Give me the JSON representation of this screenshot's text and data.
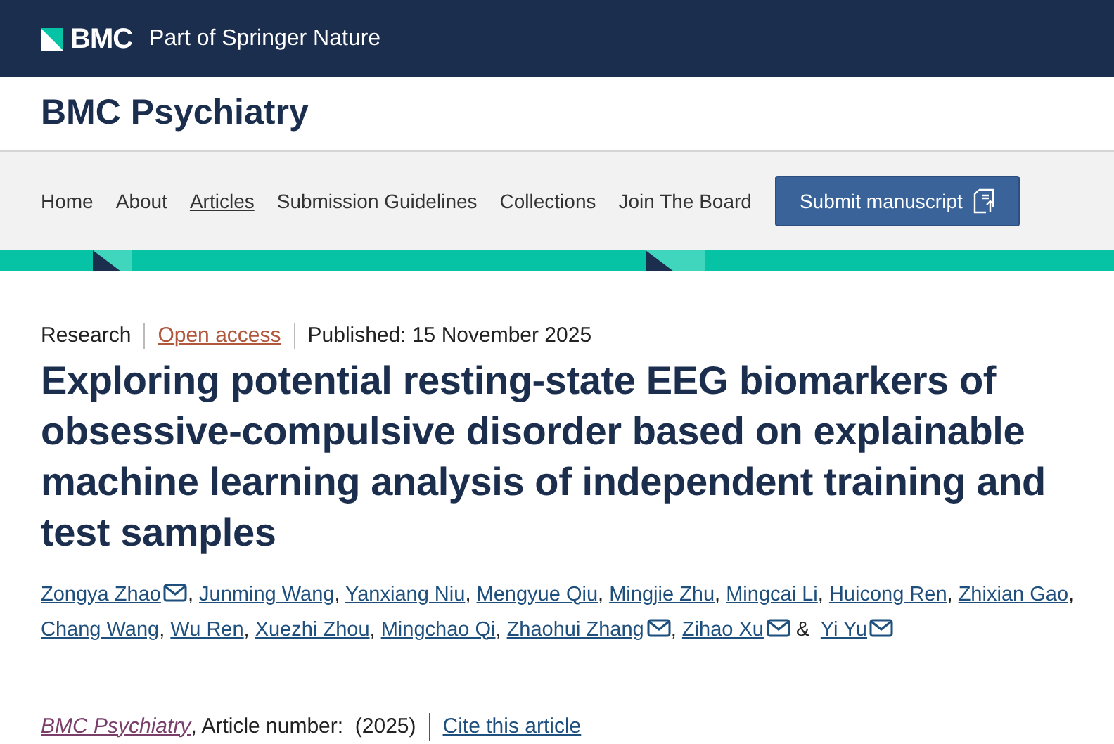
{
  "brand": {
    "logo": "BMC",
    "tagline": "Part of Springer Nature"
  },
  "journal": {
    "title": "BMC Psychiatry"
  },
  "nav": {
    "items": [
      {
        "label": "Home",
        "selected": false
      },
      {
        "label": "About",
        "selected": false
      },
      {
        "label": "Articles",
        "selected": true
      },
      {
        "label": "Submission Guidelines",
        "selected": false
      },
      {
        "label": "Collections",
        "selected": false
      },
      {
        "label": "Join The Board",
        "selected": false
      }
    ],
    "button": "Submit manuscript"
  },
  "article": {
    "type": "Research",
    "access": "Open access",
    "published": "Published: 15 November 2025",
    "title": "Exploring potential resting-state EEG biomarkers of obsessive-compulsive disorder based on explainable machine learning analysis of independent training and test samples",
    "authors": [
      {
        "name": "Zongya Zhao",
        "email": true,
        "separator": ","
      },
      {
        "name": "Junming Wang",
        "email": false,
        "separator": ","
      },
      {
        "name": "Yanxiang Niu",
        "email": false,
        "separator": ","
      },
      {
        "name": "Mengyue Qiu",
        "email": false,
        "separator": ","
      },
      {
        "name": "Mingjie Zhu",
        "email": false,
        "separator": ","
      },
      {
        "name": "Mingcai Li",
        "email": false,
        "separator": ","
      },
      {
        "name": "Huicong Ren",
        "email": false,
        "separator": ","
      },
      {
        "name": "Zhixian Gao",
        "email": false,
        "separator": ","
      },
      {
        "name": "Chang Wang",
        "email": false,
        "separator": ","
      },
      {
        "name": "Wu Ren",
        "email": false,
        "separator": ","
      },
      {
        "name": "Xuezhi Zhou",
        "email": false,
        "separator": ","
      },
      {
        "name": "Mingchao Qi",
        "email": false,
        "separator": ","
      },
      {
        "name": "Zhaohui Zhang",
        "email": true,
        "separator": ","
      },
      {
        "name": "Zihao Xu",
        "email": true,
        "separator": "&"
      },
      {
        "name": "Yi Yu",
        "email": true
      }
    ],
    "citation": {
      "journal": "BMC Psychiatry",
      "number": ", Article number:  (2025)",
      "cite": "Cite this article"
    }
  }
}
